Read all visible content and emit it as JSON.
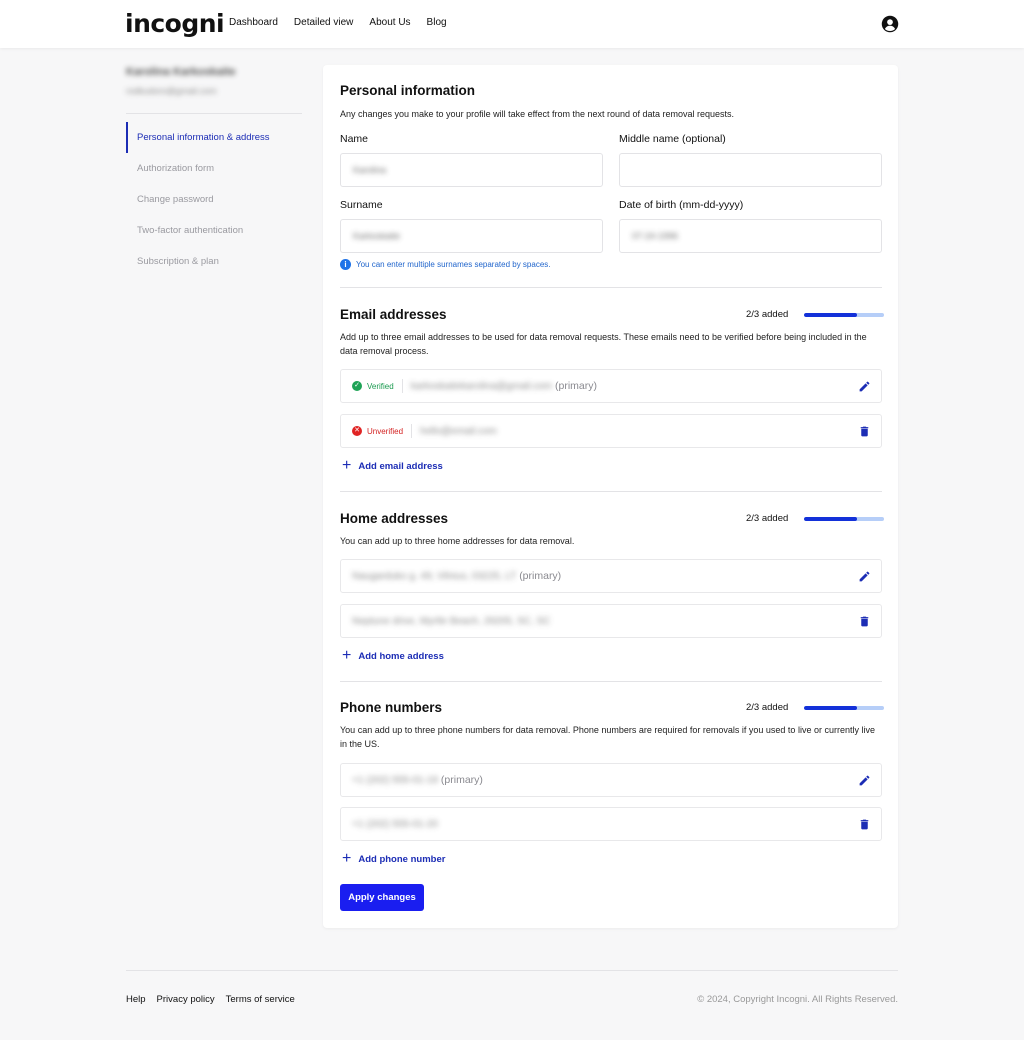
{
  "app": {
    "logo": "incogni"
  },
  "nav": {
    "items": [
      "Dashboard",
      "Detailed view",
      "About Us",
      "Blog"
    ]
  },
  "user": {
    "name": "Karolina Karkoskaite",
    "email": "rodkudoro@gmail.com"
  },
  "sidebar": {
    "items": [
      {
        "label": "Personal information & address",
        "active": true
      },
      {
        "label": "Authorization form",
        "active": false
      },
      {
        "label": "Change password",
        "active": false
      },
      {
        "label": "Two-factor authentication",
        "active": false
      },
      {
        "label": "Subscription & plan",
        "active": false
      }
    ]
  },
  "personal": {
    "title": "Personal information",
    "description": "Any changes you make to your profile will take effect from the next round of data removal requests.",
    "fields": {
      "name": {
        "label": "Name",
        "value": "Karolina"
      },
      "middle": {
        "label": "Middle name (optional)",
        "value": ""
      },
      "surname": {
        "label": "Surname",
        "value": "Karkoskaite"
      },
      "dob": {
        "label": "Date of birth (mm-dd-yyyy)",
        "value": "07-24-1996"
      }
    },
    "hint": "You can enter multiple surnames separated by spaces."
  },
  "email": {
    "title": "Email addresses",
    "progress_text": "2/3 added",
    "progress_fraction": 0.667,
    "description": "Add up to three email addresses to be used for data removal requests. These emails need to be verified before being included in the data removal process.",
    "items": [
      {
        "status": "Verified",
        "value": "karkoskaitekarolina@gmail.com",
        "primary": "(primary)"
      },
      {
        "status": "Unverified",
        "value": "hello@email.com",
        "primary": ""
      }
    ],
    "add_label": "Add email address"
  },
  "home": {
    "title": "Home addresses",
    "progress_text": "2/3 added",
    "progress_fraction": 0.667,
    "description": "You can add up to three home addresses for data removal.",
    "items": [
      {
        "value": "Naugarduko g. 49, Vilnius, 03225, LT",
        "primary": "(primary)"
      },
      {
        "value": "Neptune drive, Myrtle Beach, 29205, SC, SC",
        "primary": ""
      }
    ],
    "add_label": "Add home address"
  },
  "phone": {
    "title": "Phone numbers",
    "progress_text": "2/3 added",
    "progress_fraction": 0.667,
    "description": "You can add up to three phone numbers for data removal. Phone numbers are required for removals if you used to live or currently live in the US.",
    "items": [
      {
        "value": "+1 (202) 555-01-19",
        "primary": "(primary)"
      },
      {
        "value": "+1 (202) 555-01-20",
        "primary": ""
      }
    ],
    "add_label": "Add phone number"
  },
  "actions": {
    "apply_label": "Apply changes"
  },
  "footer": {
    "links": [
      "Help",
      "Privacy policy",
      "Terms of service"
    ],
    "copyright": "© 2024, Copyright Incogni. All Rights Reserved."
  },
  "colors": {
    "accent": "#1c2db5",
    "button": "#1a1ef0",
    "verified": "#1ea356",
    "unverified": "#e02424"
  }
}
